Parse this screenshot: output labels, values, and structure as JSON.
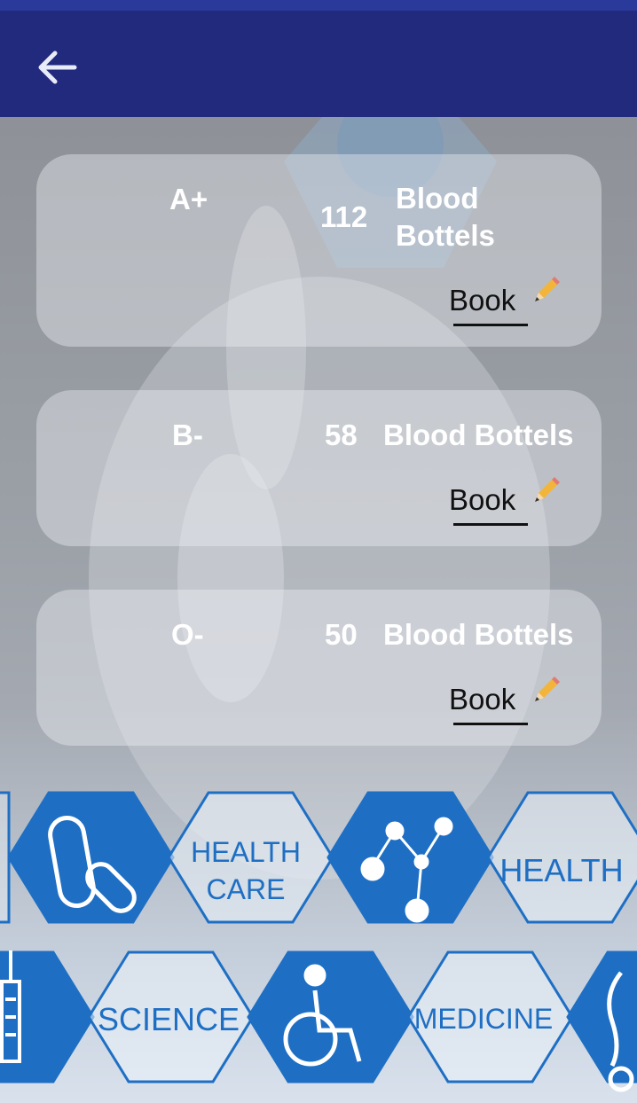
{
  "header": {
    "back_icon": "arrow-left-icon"
  },
  "items": [
    {
      "group": "A+",
      "count": "112",
      "unit_line1": "Blood",
      "unit_line2": "Bottels",
      "book_label": "Book",
      "book_icon": "pencil-icon"
    },
    {
      "group": "B-",
      "count": "58",
      "unit": "Blood Bottels",
      "book_label": "Book",
      "book_icon": "pencil-icon"
    },
    {
      "group": "O-",
      "count": "50",
      "unit": "Blood Bottels",
      "book_label": "Book",
      "book_icon": "pencil-icon"
    }
  ],
  "background_labels": [
    "HEALTH CARE",
    "HEALTH",
    "SCIENCE",
    "MEDICINE"
  ],
  "colors": {
    "appbar": "#212a7d",
    "statusbar": "#2a3a9a",
    "hex_blue": "#1e6fc4"
  }
}
